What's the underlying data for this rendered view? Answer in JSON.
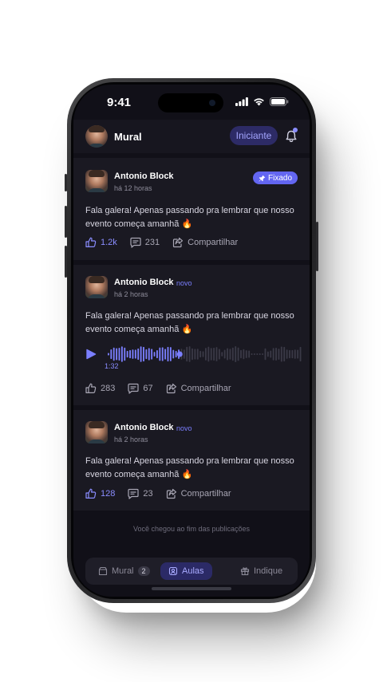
{
  "status_bar": {
    "time": "9:41"
  },
  "header": {
    "title": "Mural",
    "level_label": "Iniciante",
    "has_notification": true
  },
  "posts": [
    {
      "author": "Antonio Block",
      "time_ago": "há 12 horas",
      "pinned_label": "Fixado",
      "text": "Fala galera! Apenas passando pra lembrar que nosso evento começa amanhã 🔥",
      "likes": "1.2k",
      "liked": true,
      "comments": "231",
      "share_label": "Compartilhar"
    },
    {
      "author": "Antonio Block",
      "new_label": "novo",
      "time_ago": "há 2 horas",
      "text": "Fala galera! Apenas passando pra lembrar que nosso evento começa amanhã 🔥",
      "audio": {
        "duration": "1:32",
        "progress": 0.37
      },
      "likes": "283",
      "liked": false,
      "comments": "67",
      "share_label": "Compartilhar"
    },
    {
      "author": "Antonio Block",
      "new_label": "novo",
      "time_ago": "há 2 horas",
      "text": "Fala galera! Apenas passando pra lembrar que nosso evento começa amanhã 🔥",
      "likes": "128",
      "liked": true,
      "comments": "23",
      "share_label": "Compartilhar"
    }
  ],
  "end_message": "Você chegou ao fim das publicações",
  "tabs": [
    {
      "label": "Mural",
      "badge": "2",
      "icon": "mural-icon"
    },
    {
      "label": "Aulas",
      "icon": "aulas-icon",
      "active": true
    },
    {
      "label": "Indique",
      "icon": "gift-icon"
    }
  ],
  "colors": {
    "accent": "#6366f1",
    "background": "#111018",
    "card": "#1a1922"
  }
}
